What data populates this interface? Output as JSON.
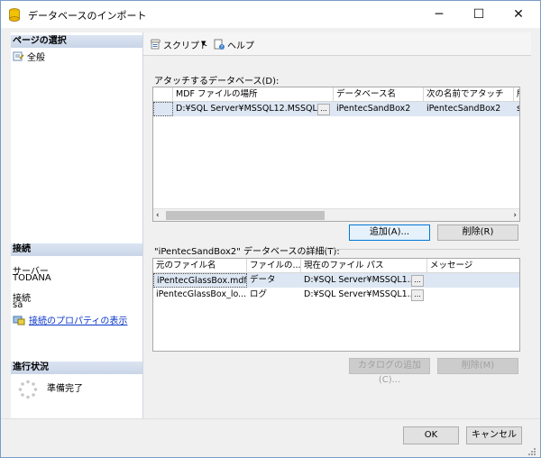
{
  "window": {
    "title": "データベースのインポート",
    "minimize": "─",
    "maximize": "☐",
    "close": "✕"
  },
  "sidebar": {
    "page_select_header": "ページの選択",
    "general_item": "全般",
    "connection_header": "接続",
    "server_label": "サーバー",
    "server_value": "TODANA",
    "connection_label": "接続",
    "connection_value": "sa",
    "connection_props_link": "接続のプロパティの表示",
    "progress_header": "進行状況",
    "progress_status": "準備完了"
  },
  "toolbar": {
    "script_label": "スクリプト",
    "dropdown_glyph": "▼",
    "help_label": "ヘルプ"
  },
  "attach": {
    "label": "アタッチするデータベース(D):",
    "columns": [
      "MDF ファイルの場所",
      "データベース名",
      "次の名前でアタッチ",
      "所"
    ],
    "rows": [
      {
        "mdf": "D:¥SQL Server¥MSSQL12.MSSQL...",
        "db_name": "iPentecSandBox2",
        "attach_as": "iPentecSandBox2",
        "owner": "s"
      }
    ],
    "ellipsis": "...",
    "add_button": "追加(A)...",
    "remove_button": "削除(R)"
  },
  "details": {
    "label": "\"iPentecSandBox2\" データベースの詳細(T):",
    "columns": [
      "元のファイル名",
      "ファイルの...",
      "現在のファイル パス",
      "メッセージ"
    ],
    "rows": [
      {
        "file": "iPentecGlassBox.mdf",
        "type": "データ",
        "path": "D:¥SQL Server¥MSSQL1...",
        "message": ""
      },
      {
        "file": "iPentecGlassBox_lo...",
        "type": "ログ",
        "path": "D:¥SQL Server¥MSSQL1...",
        "message": ""
      }
    ],
    "ellipsis": "...",
    "add_catalog_button": "カタログの追加(C)...",
    "remove_button": "削除(M)"
  },
  "footer": {
    "ok_button": "OK",
    "cancel_button": "キャンセル"
  },
  "colors": {
    "accent": "#0078d7",
    "link": "#0a36c8",
    "selection": "#dde7f3"
  }
}
